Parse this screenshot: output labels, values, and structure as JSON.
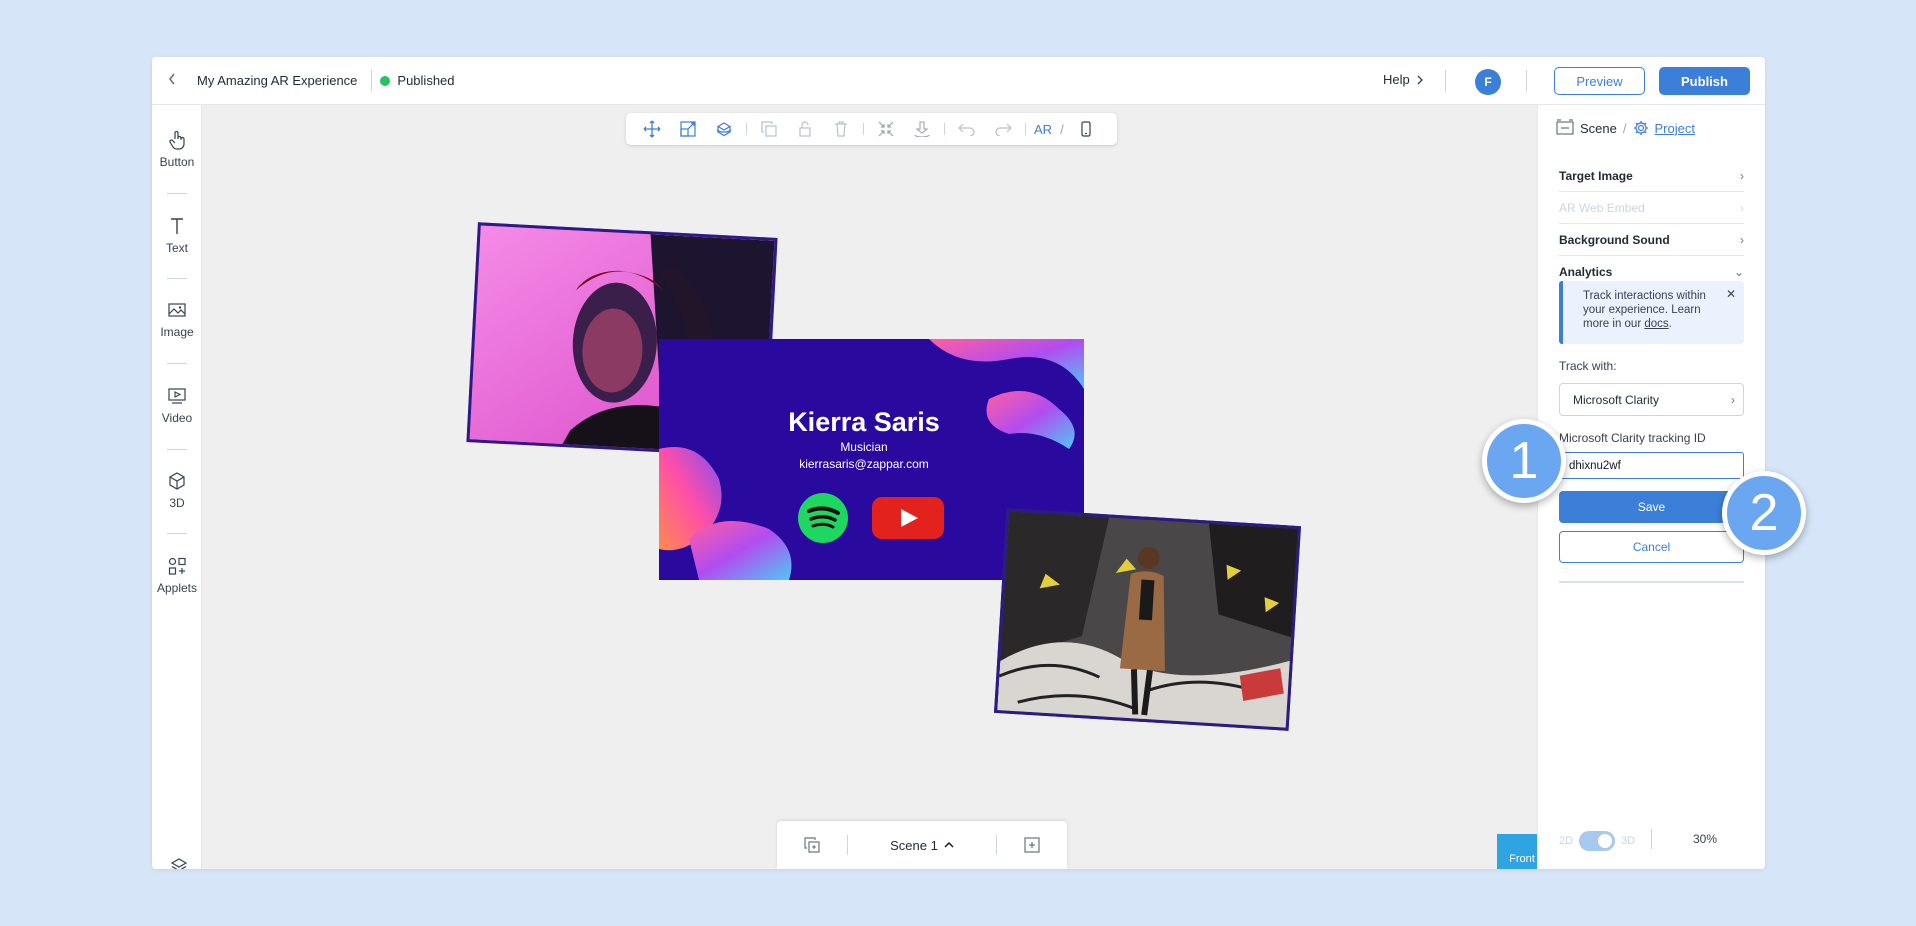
{
  "header": {
    "title": "My Amazing AR Experience",
    "status": "Published",
    "help_label": "Help",
    "avatar_initial": "F",
    "preview_label": "Preview",
    "publish_label": "Publish"
  },
  "left_toolbar": {
    "items": [
      {
        "label": "Button",
        "icon": "hand-pointer-icon"
      },
      {
        "label": "Text",
        "icon": "text-icon"
      },
      {
        "label": "Image",
        "icon": "image-icon"
      },
      {
        "label": "Video",
        "icon": "video-icon"
      },
      {
        "label": "3D",
        "icon": "cube-icon"
      },
      {
        "label": "Applets",
        "icon": "applets-icon"
      }
    ]
  },
  "canvas_toolbar": {
    "ar_label": "AR",
    "separator": "/"
  },
  "business_card": {
    "name": "Kierra Saris",
    "role": "Musician",
    "email": "kierrasaris@zappar.com"
  },
  "bottom_bar": {
    "scene_label": "Scene 1"
  },
  "front_label": "Front",
  "right_panel": {
    "tab_scene": "Scene",
    "tab_separator": "/",
    "tab_project": "Project",
    "sections": [
      {
        "label": "Target Image",
        "disabled": false
      },
      {
        "label": "AR Web Embed",
        "disabled": true
      },
      {
        "label": "Background Sound",
        "disabled": false
      },
      {
        "label": "Analytics",
        "disabled": false
      }
    ],
    "info_text_1": "Track interactions within your experience. Learn more in our ",
    "info_link": "docs",
    "info_text_2": ".",
    "track_with_label": "Track with:",
    "track_with_value": "Microsoft Clarity",
    "tracking_id_label": "Microsoft Clarity tracking ID",
    "tracking_id_value": "dhixnu2wf",
    "save_label": "Save",
    "cancel_label": "Cancel",
    "toggle_2d": "2D",
    "toggle_3d": "3D",
    "zoom": "30%"
  },
  "callouts": [
    "1",
    "2"
  ],
  "colors": {
    "accent": "#3b7fd9",
    "published": "#22c55e",
    "card_bg": "#2a0a9e",
    "front_button": "#2ea4e0"
  }
}
